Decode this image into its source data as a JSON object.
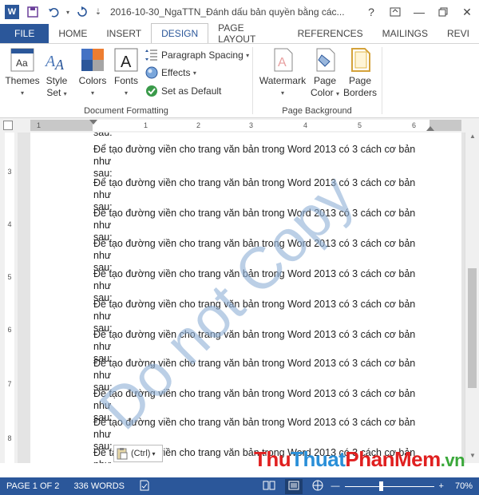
{
  "app": {
    "title": "2016-10-30_NgaTTN_Đánh dấu bản quyền bằng các...",
    "help": "?",
    "logo_letter": "W"
  },
  "tabs": [
    "FILE",
    "HOME",
    "INSERT",
    "DESIGN",
    "PAGE LAYOUT",
    "REFERENCES",
    "MAILINGS",
    "REVI"
  ],
  "active_tab": "DESIGN",
  "ribbon": {
    "doc_formatting": {
      "label": "Document Formatting",
      "themes": "Themes",
      "style_set_1": "Style",
      "style_set_2": "Set",
      "colors": "Colors",
      "fonts": "Fonts",
      "paragraph_spacing": "Paragraph Spacing",
      "effects": "Effects",
      "set_as_default": "Set as Default"
    },
    "page_background": {
      "label": "Page Background",
      "watermark": "Watermark",
      "page_color_1": "Page",
      "page_color_2": "Color",
      "page_borders_1": "Page",
      "page_borders_2": "Borders"
    }
  },
  "ruler": {
    "numbers": [
      "1",
      "1",
      "2",
      "3",
      "4",
      "5",
      "6"
    ]
  },
  "vruler": {
    "numbers": [
      "3",
      "4",
      "5",
      "6",
      "7",
      "8"
    ]
  },
  "document": {
    "top_fragment": "sau:",
    "paragraph_line1": "Để tạo đường viền cho trang văn bản trong Word 2013 có 3 cách cơ bản như",
    "paragraph_line2": "sau:",
    "watermark_text": "Do not Copy"
  },
  "paste_options": "(Ctrl)",
  "brand": {
    "part1": "Thu",
    "part2": "Thuat",
    "part3": "PhanMem",
    "part4": ".vn"
  },
  "status": {
    "page": "PAGE 1 OF 2",
    "words": "336 WORDS",
    "zoom": "70%",
    "zoom_fraction": 0.4
  },
  "colors": {
    "accent": "#2b579a",
    "watermark": "#8fb0d6"
  }
}
